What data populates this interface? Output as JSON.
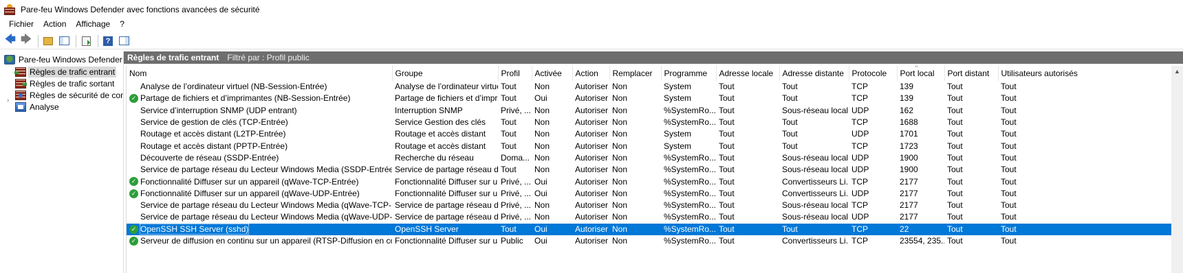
{
  "window": {
    "title": "Pare-feu Windows Defender avec fonctions avancées de sécurité"
  },
  "menu": [
    "Fichier",
    "Action",
    "Affichage",
    "?"
  ],
  "toolbar": {
    "buttons": [
      "back-icon",
      "forward-icon",
      "up-folder-icon",
      "show-console-tree-icon",
      "export-list-icon",
      "help-icon",
      "show-action-pane-icon"
    ]
  },
  "tree": {
    "root": "Pare-feu Windows Defender avec fonctions avancées de sécurité",
    "items": [
      "Règles de trafic entrant",
      "Règles de trafic sortant",
      "Règles de sécurité de connexion",
      "Analyse"
    ]
  },
  "main": {
    "header_title": "Règles de trafic entrant",
    "header_filter": "Filtré par : Profil public"
  },
  "columns": [
    "Nom",
    "Groupe",
    "Profil",
    "Activée",
    "Action",
    "Remplacer",
    "Programme",
    "Adresse locale",
    "Adresse distante",
    "Protocole",
    "Port local",
    "Port distant",
    "Utilisateurs autorisés"
  ],
  "rows": [
    {
      "enabled": false,
      "cells": [
        "Analyse de l’ordinateur virtuel (NB-Session-Entrée)",
        "Analyse de l’ordinateur virtuel",
        "Tout",
        "Non",
        "Autoriser",
        "Non",
        "System",
        "Tout",
        "Tout",
        "TCP",
        "139",
        "Tout",
        "Tout"
      ]
    },
    {
      "enabled": true,
      "cells": [
        "Partage de fichiers et d’imprimantes (NB-Session-Entrée)",
        "Partage de fichiers et d’impr...",
        "Tout",
        "Oui",
        "Autoriser",
        "Non",
        "System",
        "Tout",
        "Tout",
        "TCP",
        "139",
        "Tout",
        "Tout"
      ]
    },
    {
      "enabled": false,
      "cells": [
        "Service d’interruption SNMP (UDP entrant)",
        "Interruption SNMP",
        "Privé, ...",
        "Non",
        "Autoriser",
        "Non",
        "%SystemRo...",
        "Tout",
        "Sous-réseau local",
        "UDP",
        "162",
        "Tout",
        "Tout"
      ]
    },
    {
      "enabled": false,
      "cells": [
        "Service de gestion de clés (TCP-Entrée)",
        "Service Gestion des clés",
        "Tout",
        "Non",
        "Autoriser",
        "Non",
        "%SystemRo...",
        "Tout",
        "Tout",
        "TCP",
        "1688",
        "Tout",
        "Tout"
      ]
    },
    {
      "enabled": false,
      "cells": [
        "Routage et accès distant (L2TP-Entrée)",
        "Routage et accès distant",
        "Tout",
        "Non",
        "Autoriser",
        "Non",
        "System",
        "Tout",
        "Tout",
        "UDP",
        "1701",
        "Tout",
        "Tout"
      ]
    },
    {
      "enabled": false,
      "cells": [
        "Routage et accès distant (PPTP-Entrée)",
        "Routage et accès distant",
        "Tout",
        "Non",
        "Autoriser",
        "Non",
        "System",
        "Tout",
        "Tout",
        "TCP",
        "1723",
        "Tout",
        "Tout"
      ]
    },
    {
      "enabled": false,
      "cells": [
        "Découverte de réseau (SSDP-Entrée)",
        "Recherche du réseau",
        "Doma...",
        "Non",
        "Autoriser",
        "Non",
        "%SystemRo...",
        "Tout",
        "Sous-réseau local",
        "UDP",
        "1900",
        "Tout",
        "Tout"
      ]
    },
    {
      "enabled": false,
      "cells": [
        "Service de partage réseau du Lecteur Windows Media (SSDP-Entrée)",
        "Service de partage réseau d...",
        "Tout",
        "Non",
        "Autoriser",
        "Non",
        "%SystemRo...",
        "Tout",
        "Sous-réseau local",
        "UDP",
        "1900",
        "Tout",
        "Tout"
      ]
    },
    {
      "enabled": true,
      "cells": [
        "Fonctionnalité Diffuser sur un appareil (qWave-TCP-Entrée)",
        "Fonctionnalité Diffuser sur u...",
        "Privé, ...",
        "Oui",
        "Autoriser",
        "Non",
        "%SystemRo...",
        "Tout",
        "Convertisseurs Li...",
        "TCP",
        "2177",
        "Tout",
        "Tout"
      ]
    },
    {
      "enabled": true,
      "cells": [
        "Fonctionnalité Diffuser sur un appareil (qWave-UDP-Entrée)",
        "Fonctionnalité Diffuser sur u...",
        "Privé, ...",
        "Oui",
        "Autoriser",
        "Non",
        "%SystemRo...",
        "Tout",
        "Convertisseurs Li...",
        "UDP",
        "2177",
        "Tout",
        "Tout"
      ]
    },
    {
      "enabled": false,
      "cells": [
        "Service de partage réseau du Lecteur Windows Media (qWave-TCP-Entrée)",
        "Service de partage réseau d...",
        "Privé, ...",
        "Non",
        "Autoriser",
        "Non",
        "%SystemRo...",
        "Tout",
        "Sous-réseau local",
        "TCP",
        "2177",
        "Tout",
        "Tout"
      ]
    },
    {
      "enabled": false,
      "cells": [
        "Service de partage réseau du Lecteur Windows Media (qWave-UDP-Entrée)",
        "Service de partage réseau d...",
        "Privé, ...",
        "Non",
        "Autoriser",
        "Non",
        "%SystemRo...",
        "Tout",
        "Sous-réseau local",
        "UDP",
        "2177",
        "Tout",
        "Tout"
      ]
    },
    {
      "enabled": true,
      "selected": true,
      "cells": [
        "OpenSSH SSH Server (sshd)",
        "OpenSSH Server",
        "Tout",
        "Oui",
        "Autoriser",
        "Non",
        "%SystemRo...",
        "Tout",
        "Tout",
        "TCP",
        "22",
        "Tout",
        "Tout"
      ]
    },
    {
      "enabled": true,
      "cells": [
        "Serveur de diffusion en continu sur un appareil (RTSP-Diffusion en continu...",
        "Fonctionnalité Diffuser sur u...",
        "Public",
        "Oui",
        "Autoriser",
        "Non",
        "%SystemRo...",
        "Tout",
        "Convertisseurs Li...",
        "TCP",
        "23554, 235...",
        "Tout",
        "Tout"
      ]
    }
  ],
  "colors": {
    "selection": "#0078d7",
    "header_bar": "#6e6e6e",
    "enabled_check": "#2c9e3a"
  }
}
